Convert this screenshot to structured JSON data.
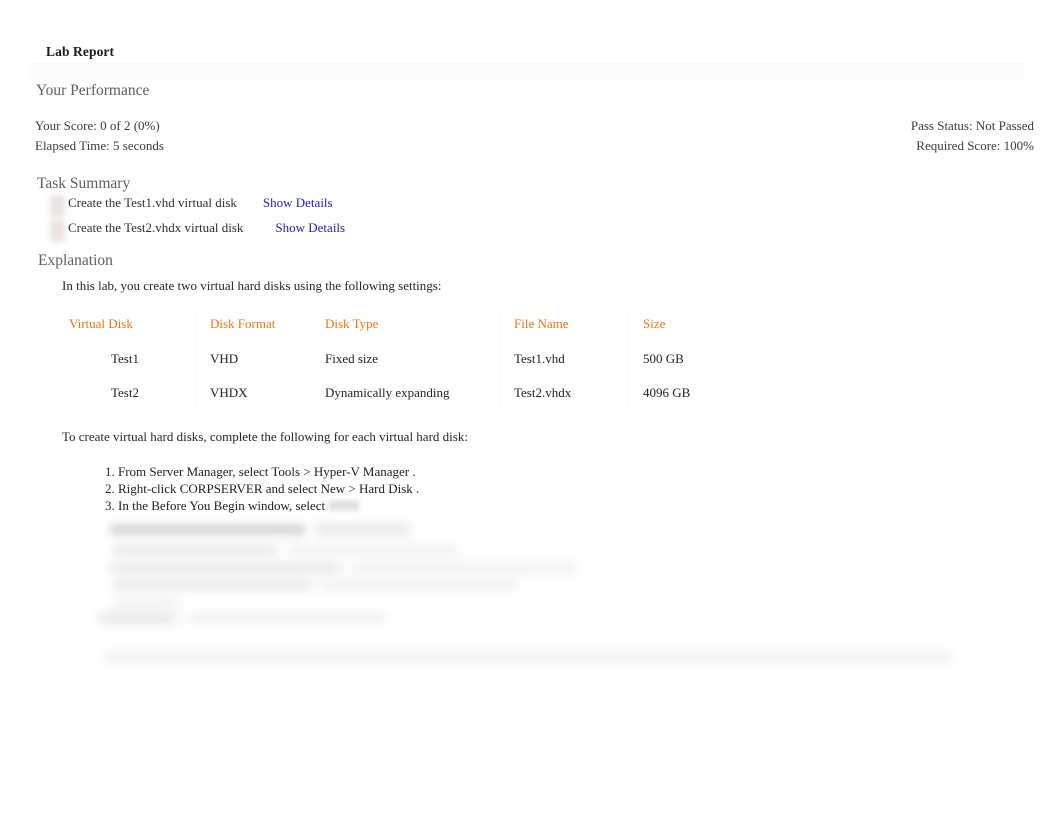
{
  "page_title": "Lab Report",
  "performance": {
    "heading": "Your Performance",
    "score_label": "Your Score: 0 of 2 (0%)",
    "elapsed_label": "Elapsed Time: 5 seconds",
    "pass_status_label": "Pass Status: Not Passed",
    "required_score_label": "Required Score: 100%"
  },
  "task_summary": {
    "heading": "Task Summary",
    "tasks": [
      {
        "label": "Create the Test1.vhd virtual disk",
        "link": "Show Details",
        "status_icon": "incorrect-status-icon"
      },
      {
        "label": "Create the Test2.vhdx virtual disk",
        "link": "Show Details",
        "status_icon": "incorrect-status-icon"
      }
    ]
  },
  "explanation": {
    "heading": "Explanation",
    "intro": "In this lab, you create two virtual hard disks using the following settings:",
    "steps_intro": "To create virtual hard disks, complete the following for each virtual hard disk:",
    "steps": [
      "From Server Manager, select Tools  > Hyper-V Manager  .",
      "Right-click CORPSERVER   and select New > Hard Disk .",
      "In the Before You Begin window, select"
    ]
  },
  "settings_table": {
    "columns": [
      "Virtual Disk",
      "Disk Format",
      "Disk Type",
      "File Name",
      "Size"
    ],
    "rows": [
      [
        "Test1",
        "VHD",
        "Fixed size",
        "Test1.vhd",
        "500 GB"
      ],
      [
        "Test2",
        "VHDX",
        "Dynamically expanding",
        "Test2.vhdx",
        "4096 GB"
      ]
    ]
  },
  "colors": {
    "table_header": "#e8761e",
    "link": "#2222a8",
    "heading": "#5e5e5e",
    "body_text": "#262626",
    "panel_topbar": "#fbfbfc"
  }
}
